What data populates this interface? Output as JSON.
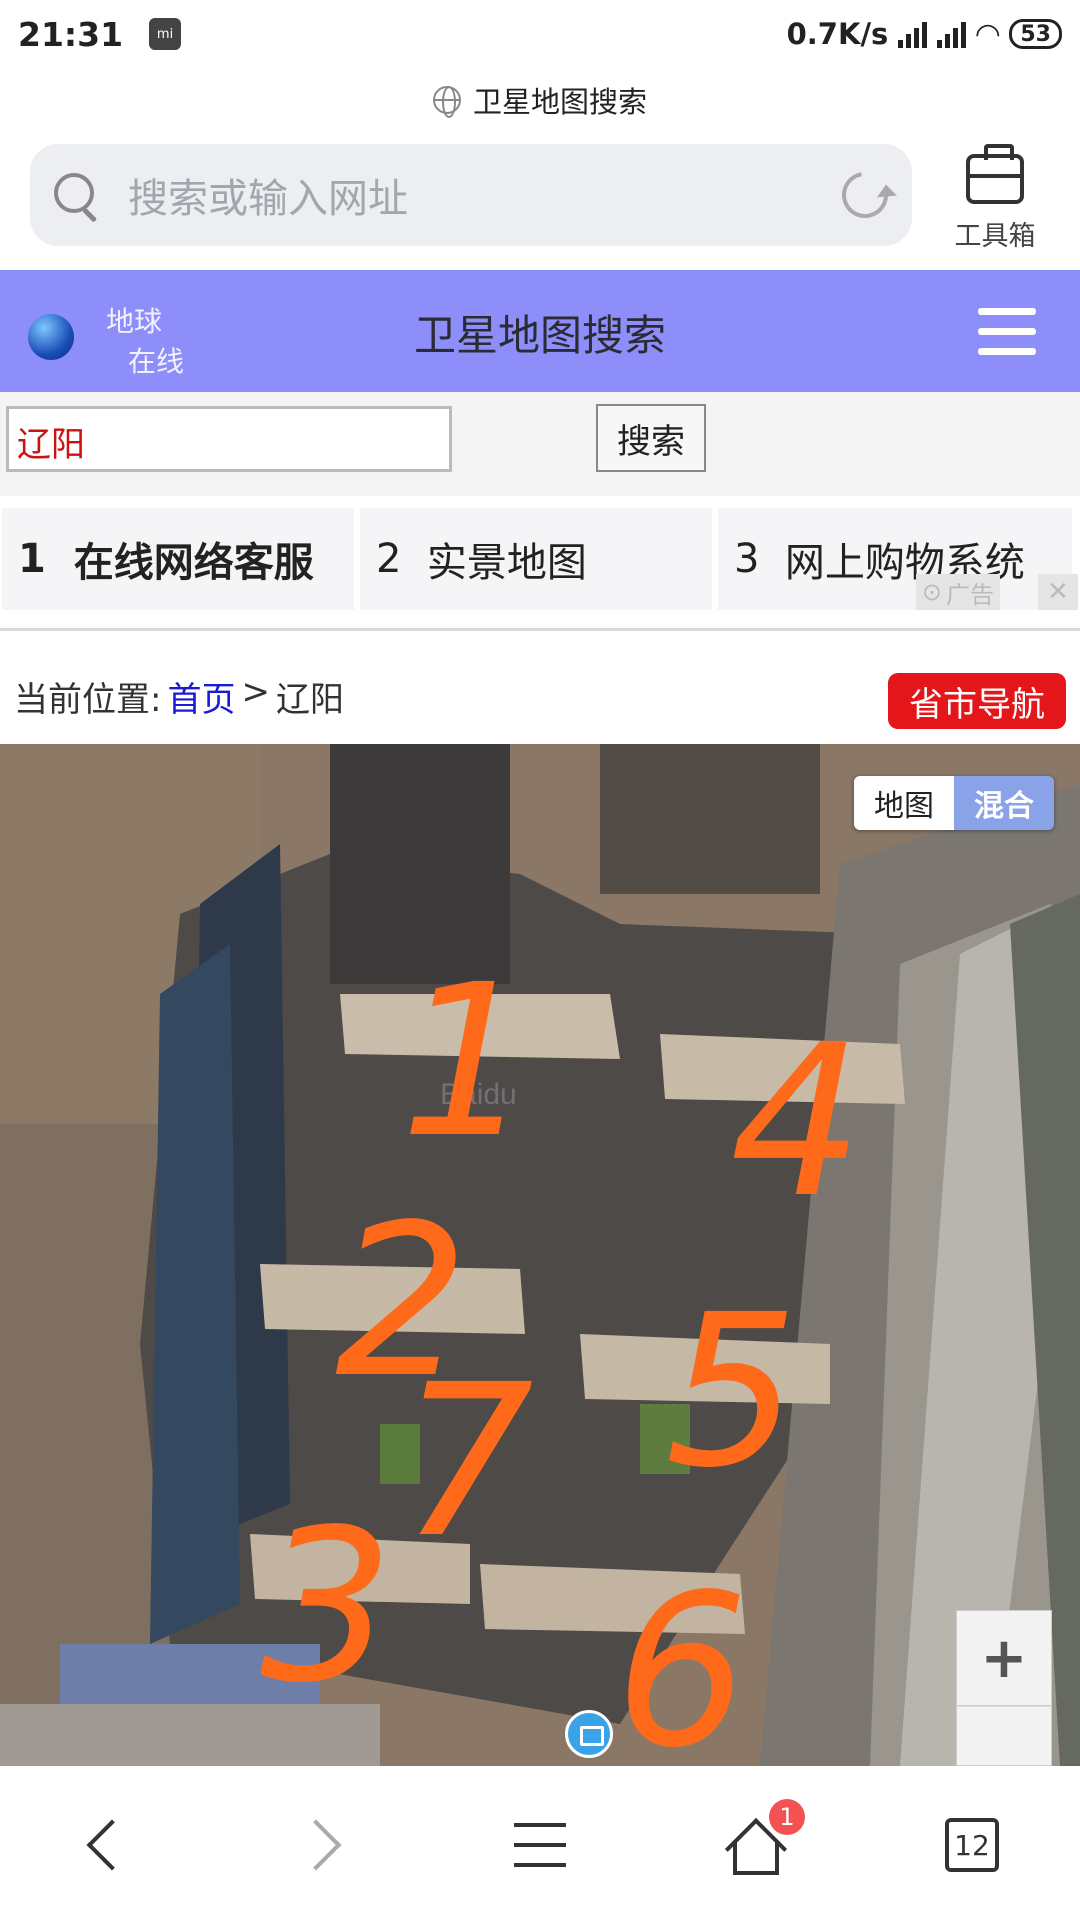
{
  "status_bar": {
    "time": "21:31",
    "network_speed": "0.7K/s",
    "battery": "53"
  },
  "browser": {
    "page_title": "卫星地图搜索",
    "search_placeholder": "搜索或输入网址",
    "toolbox_label": "工具箱",
    "tabs_count": "12",
    "home_badge": "1"
  },
  "site": {
    "logo_line1": "地球",
    "logo_line2": "在线",
    "title": "卫星地图搜索",
    "search_value": "辽阳",
    "search_button": "搜索",
    "ad_links": [
      {
        "num": "1",
        "label": "在线网络客服"
      },
      {
        "num": "2",
        "label": "实景地图"
      },
      {
        "num": "3",
        "label": "网上购物系统"
      }
    ],
    "ad_badge": "广告",
    "breadcrumb": {
      "prefix": "当前位置:",
      "home": "首页",
      "sep": ">",
      "current": "辽阳"
    },
    "province_nav": "省市导航"
  },
  "map": {
    "toggle_map": "地图",
    "toggle_hybrid": "混合",
    "zoom_in": "+",
    "watermark": "Baidu",
    "annotations": [
      "1",
      "4",
      "2",
      "5",
      "7",
      "3",
      "6"
    ],
    "annotation_color": "#ff6a1a"
  }
}
